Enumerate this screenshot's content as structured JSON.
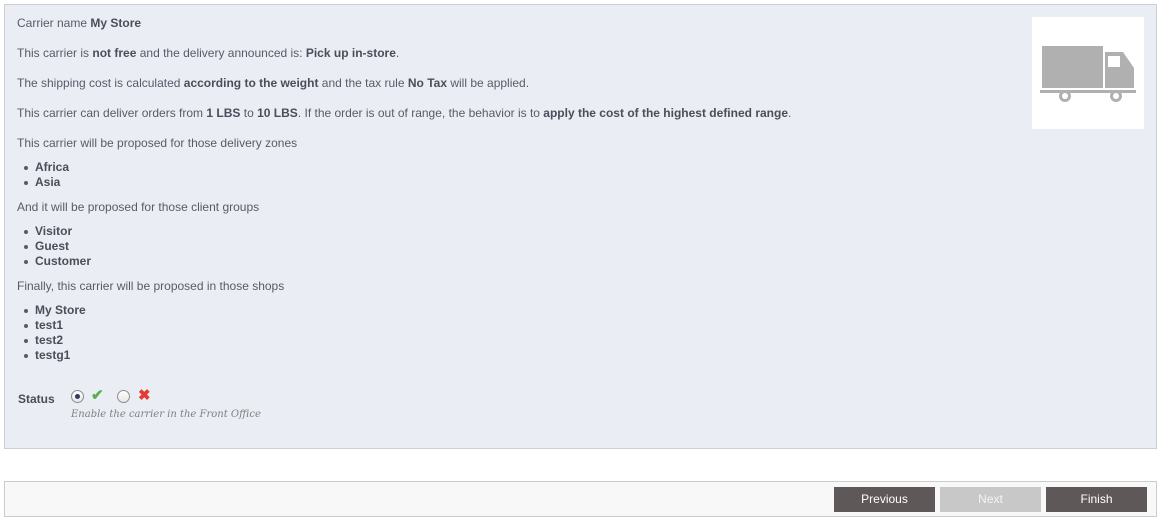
{
  "summary": {
    "carrier_name_label": "Carrier name",
    "carrier_name": "My Store",
    "line1": {
      "prefix": "This carrier is",
      "free_status": "not free",
      "mid": "and the delivery announced is:",
      "delay": "Pick up in-store",
      "suffix": "."
    },
    "line2": {
      "prefix": "The shipping cost is calculated",
      "method": "according to the weight",
      "mid": "and the tax rule",
      "tax_rule": "No Tax",
      "suffix": "will be applied."
    },
    "line3": {
      "prefix": "This carrier can deliver orders from",
      "range_min": "1 LBS",
      "to": "to",
      "range_max": "10 LBS",
      "mid": ". If the order is out of range, the behavior is to",
      "behavior": "apply the cost of the highest defined range",
      "suffix": "."
    },
    "zones_intro": "This carrier will be proposed for those delivery zones",
    "zones": [
      "Africa",
      "Asia"
    ],
    "groups_intro": "And it will be proposed for those client groups",
    "groups": [
      "Visitor",
      "Guest",
      "Customer"
    ],
    "shops_intro": "Finally, this carrier will be proposed in those shops",
    "shops": [
      "My Store",
      "test1",
      "test2",
      "testg1"
    ]
  },
  "logo": {
    "icon": "truck-icon",
    "color": "#b0b0b0"
  },
  "status": {
    "label": "Status",
    "enabled": true,
    "enabled_icon": "✔",
    "disabled_icon": "✖",
    "enabled_color": "#59b04a",
    "disabled_color": "#e43b33",
    "hint": "Enable the carrier in the Front Office"
  },
  "footer": {
    "previous_label": "Previous",
    "next_label": "Next",
    "finish_label": "Finish"
  }
}
